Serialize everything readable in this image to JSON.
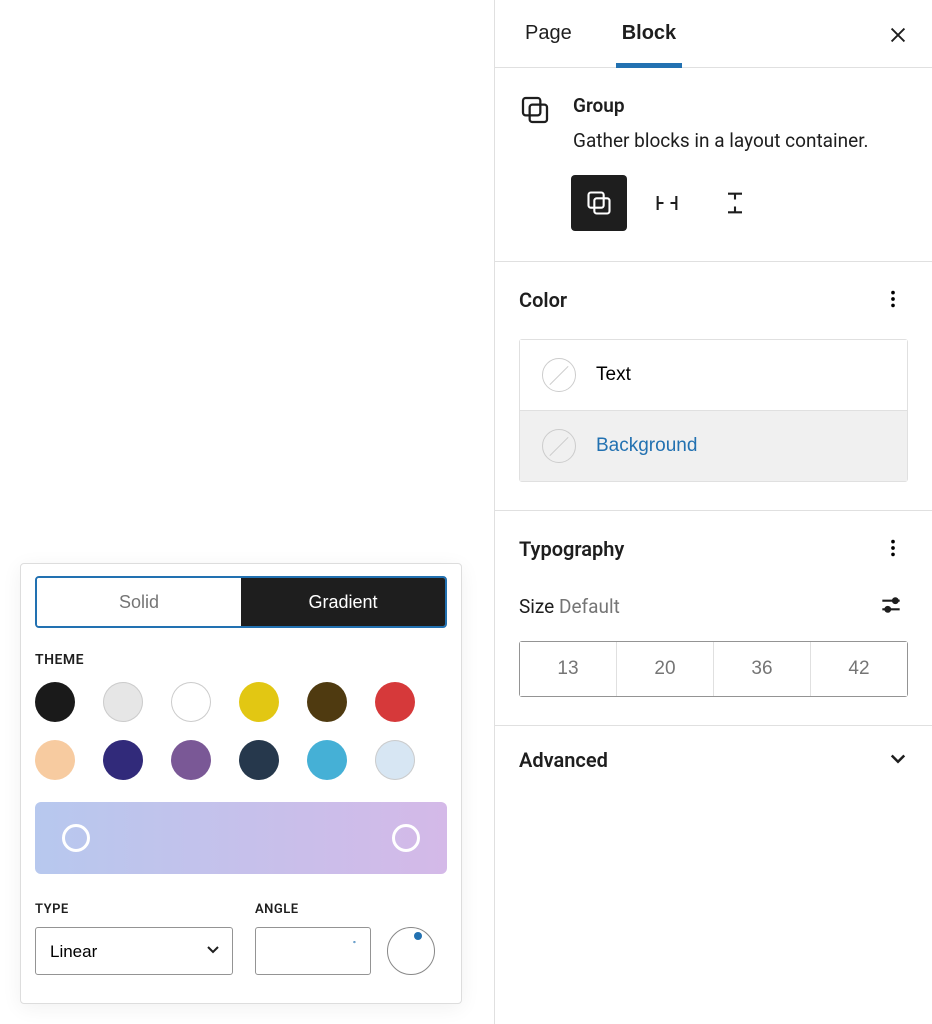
{
  "tabs": {
    "page": "Page",
    "block": "Block",
    "active": "block"
  },
  "block": {
    "title": "Group",
    "description": "Gather blocks in a layout container."
  },
  "colorPanel": {
    "title": "Color",
    "items": {
      "text": "Text",
      "background": "Background"
    },
    "active": "background"
  },
  "typography": {
    "title": "Typography",
    "sizeLabel": "Size",
    "sizeValue": "Default",
    "presets": [
      "13",
      "20",
      "36",
      "42"
    ]
  },
  "advanced": {
    "title": "Advanced"
  },
  "picker": {
    "tabs": {
      "solid": "Solid",
      "gradient": "Gradient",
      "active": "gradient"
    },
    "theme_label": "THEME",
    "theme_colors": [
      "#1a1a1a",
      "#e6e6e6",
      "#ffffff",
      "#e2c713",
      "#4f3a10",
      "#d6393a",
      "#f7cba0",
      "#312a7a",
      "#7a5896",
      "#26384c",
      "#45b0d6",
      "#d7e6f3"
    ],
    "gradient": {
      "css": "linear-gradient(90deg, #b7c8ee 0%, #d4b9e8 100%)",
      "stops": [
        0,
        100
      ]
    },
    "type_label": "TYPE",
    "type_value": "Linear",
    "angle_label": "ANGLE",
    "angle_value": ""
  }
}
